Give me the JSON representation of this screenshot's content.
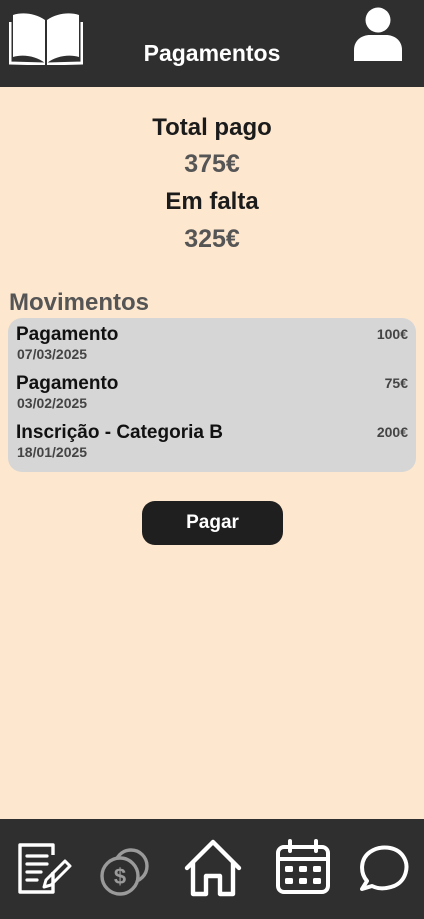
{
  "header": {
    "title": "Pagamentos",
    "logo_icon": "open-book-icon",
    "profile_icon": "user-icon"
  },
  "summary": {
    "total_paid_label": "Total pago",
    "total_paid_value": "375€",
    "missing_label": "Em falta",
    "missing_value": "325€"
  },
  "movements": {
    "title": "Movimentos",
    "items": [
      {
        "title": "Pagamento",
        "date": "07/03/2025",
        "amount": "100€"
      },
      {
        "title": "Pagamento",
        "date": "03/02/2025",
        "amount": "75€"
      },
      {
        "title": "Inscrição - Categoria B",
        "date": "18/01/2025",
        "amount": "200€"
      }
    ]
  },
  "actions": {
    "pay_label": "Pagar"
  },
  "bottom_nav": {
    "items": [
      {
        "icon": "document-edit-icon",
        "active": false
      },
      {
        "icon": "coins-icon",
        "active": true
      },
      {
        "icon": "home-icon",
        "active": false
      },
      {
        "icon": "calendar-icon",
        "active": false
      },
      {
        "icon": "chat-bubble-icon",
        "active": false
      }
    ]
  },
  "colors": {
    "background": "#fde7cf",
    "bars": "#2f2f2f",
    "card": "#d6d6d6",
    "button": "#1f1f1f",
    "active_icon": "#9a9a9a"
  }
}
